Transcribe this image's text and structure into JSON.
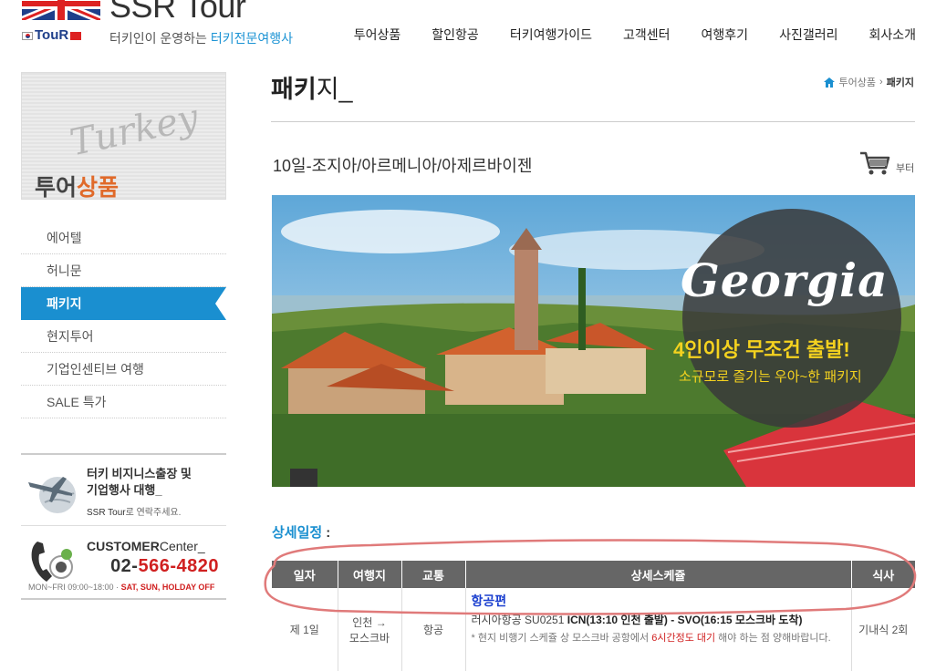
{
  "header": {
    "brand": "SSR Tour",
    "logo_small": "TouR",
    "tagline_prefix": "터키인이 운영하는",
    "tagline_highlight": "터키전문여행사",
    "nav": [
      "투어상품",
      "할인항공",
      "터키여행가이드",
      "고객센터",
      "여행후기",
      "사진갤러리",
      "회사소개"
    ]
  },
  "sidebar": {
    "visual_script": "Turkey",
    "visual_title_1": "투어",
    "visual_title_2": "상품",
    "menu": [
      "에어텔",
      "허니문",
      "패키지",
      "현지투어",
      "기업인센티브 여행",
      "SALE 특가"
    ],
    "active_index": 2,
    "business": {
      "line1": "터키 비지니스출장 및",
      "line2": "기업행사 대행_",
      "sub_brand": "SSR Tour",
      "sub_rest": "로 연락주세요."
    },
    "customer": {
      "title_bold": "CUSTOMER",
      "title_rest": "Center_",
      "phone_prefix": "02-",
      "phone_rest": "566-4820",
      "hours": "MON~FRI 09:00~18:00 · ",
      "holiday": "SAT, SUN, HOLDAY OFF"
    }
  },
  "main": {
    "page_title_bold": "패키",
    "page_title_rest": "지_",
    "breadcrumb": {
      "parent": "투어상품",
      "sep": "›",
      "current": "패키지"
    },
    "product_title": "10일-조지아/아르메니아/아제르바이젠",
    "cart_label": "부터",
    "banner": {
      "headline": "Georgia",
      "line1": "4인이상 무조건 출발!",
      "line2": "소규모로 즐기는 우아~한 패키지"
    },
    "schedule_title": "상세일정",
    "schedule_colon": ":",
    "table": {
      "headers": [
        "일자",
        "여행지",
        "교통",
        "상세스케쥴",
        "식사"
      ],
      "rows": [
        {
          "day": "제 1일",
          "place_1": "인천 →",
          "place_2": "모스크바",
          "transport": "항공",
          "detail_title": "항공편",
          "detail_airline": "러시아항공 SU0251 ",
          "detail_route": "ICN(13:10 인천 출발) - SVO(16:15 모스크바 도착)",
          "detail_note_1": "* 현지 비행기 스케쥴 상 모스크바 공항에서 ",
          "detail_note_red": "6시간정도 대기",
          "detail_note_2": " 해야 하는 점 양해바랍니다.",
          "meal": "기내식 2회"
        }
      ]
    }
  },
  "colors": {
    "accent": "#1a8fd0",
    "table_header": "#666666",
    "highlight_red": "#d02020",
    "banner_yellow": "#f4d21f"
  }
}
